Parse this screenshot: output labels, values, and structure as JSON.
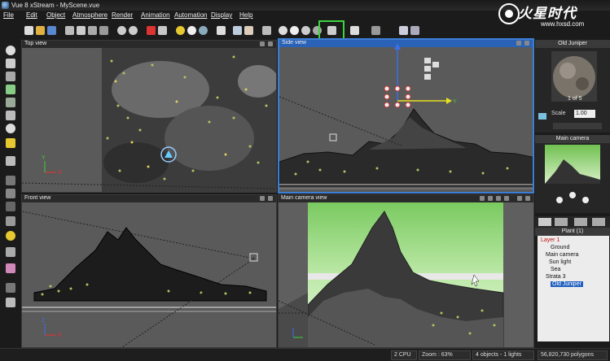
{
  "window": {
    "title": "Vue 8 xStream - MyScene.vue"
  },
  "watermark": {
    "brand": "火星时代",
    "url": "www.hxsd.com"
  },
  "menu": [
    "File",
    "Edit",
    "Object",
    "Atmosphere",
    "Render",
    "Animation",
    "Automation",
    "Display",
    "Help"
  ],
  "viewports": {
    "top": {
      "label": "Top view"
    },
    "side": {
      "label": "Side view"
    },
    "front": {
      "label": "Front view"
    },
    "camera": {
      "label": "Main camera view"
    }
  },
  "axes": {
    "x": "X",
    "y": "Y",
    "z": "Z"
  },
  "material_panel": {
    "title": "Old Juniper",
    "counter": "1 of 5",
    "scale_label": "Scale",
    "scale_value": "1.00"
  },
  "camera_panel": {
    "title": "Main camera"
  },
  "world_browser": {
    "title": "Plant (1)",
    "items": [
      {
        "label": "Layer 1",
        "kind": "layer"
      },
      {
        "label": "Ground",
        "kind": "item"
      },
      {
        "label": "Main camera",
        "kind": "item"
      },
      {
        "label": "Sun light",
        "kind": "item"
      },
      {
        "label": "Sea",
        "kind": "item"
      },
      {
        "label": "Strata 3",
        "kind": "item"
      },
      {
        "label": "Old Juniper",
        "kind": "selected"
      }
    ]
  },
  "status": {
    "cpu": "2 CPU",
    "zoom": "Zoom : 63%",
    "objects": "4 objects - 1 lights",
    "polygons": "56,820,730 polygons"
  },
  "colors": {
    "accent_highlight": "#3ed43e",
    "active_viewport": "#3d7fd6",
    "axis_x": "#e83030",
    "axis_y": "#3bd23b",
    "axis_z": "#3b6fe8"
  }
}
